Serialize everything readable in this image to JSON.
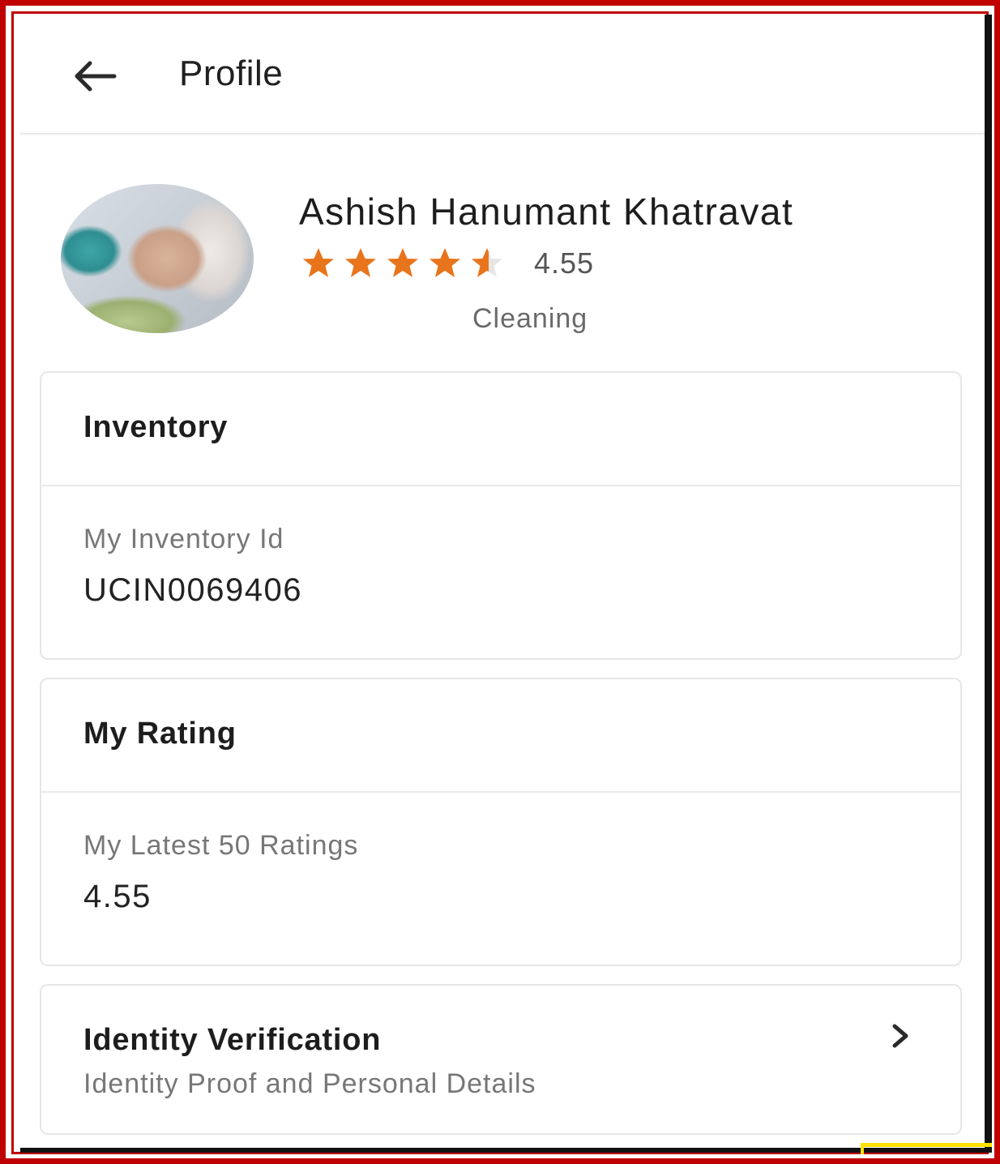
{
  "header": {
    "title": "Profile",
    "back_icon": "arrow-left-icon"
  },
  "profile": {
    "name": "Ashish Hanumant Khatravat",
    "rating": 4.55,
    "rating_text": "4.55",
    "stars_out_of": 5,
    "category": "Cleaning",
    "star_color": "#e8741c"
  },
  "inventory": {
    "title": "Inventory",
    "label": "My Inventory Id",
    "value": "UCIN0069406"
  },
  "my_rating": {
    "title": "My Rating",
    "label": "My Latest 50 Ratings",
    "value": "4.55"
  },
  "identity": {
    "title": "Identity Verification",
    "subtitle": "Identity Proof and Personal Details",
    "chevron_icon": "chevron-right-icon"
  }
}
